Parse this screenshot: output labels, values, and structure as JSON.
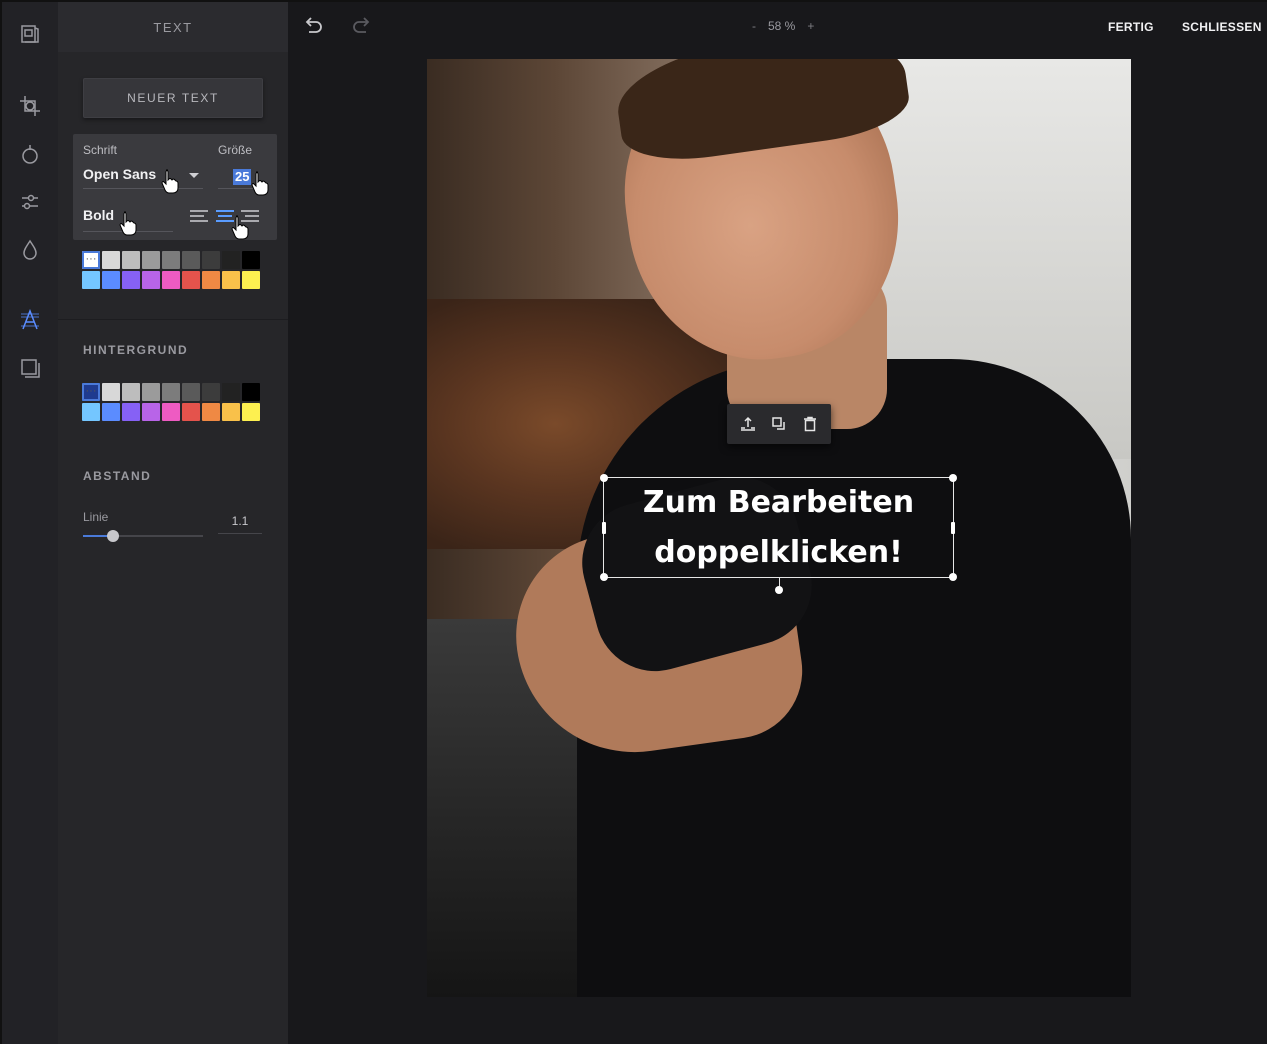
{
  "panel": {
    "title": "TEXT",
    "new_text_label": "NEUER TEXT",
    "font": {
      "font_label": "Schrift",
      "font_value": "Open Sans",
      "size_label": "Größe",
      "size_value": "25",
      "weight_value": "Bold"
    },
    "text_colors": [
      "#ffffff",
      "#d8d8d8",
      "#bdbdbd",
      "#9b9b9b",
      "#7c7c7c",
      "#5a5a5a",
      "#3c3c3c",
      "#222222",
      "#000000",
      "#74c6ff",
      "#5b8cff",
      "#8661f5",
      "#b864e8",
      "#ee5bc2",
      "#e4534c",
      "#ef8944",
      "#f9c14a",
      "#fdf050"
    ],
    "background_title": "HINTERGRUND",
    "background_colors": [
      "#1f3b8f",
      "#d8d8d8",
      "#bdbdbd",
      "#9b9b9b",
      "#7c7c7c",
      "#5a5a5a",
      "#3c3c3c",
      "#222222",
      "#000000",
      "#74c6ff",
      "#5b8cff",
      "#8661f5",
      "#b864e8",
      "#ee5bc2",
      "#e4534c",
      "#ef8944",
      "#f9c14a",
      "#fdf050"
    ],
    "spacing_title": "ABSTAND",
    "line_label": "Linie",
    "line_value": "1.1",
    "line_fraction": 0.25
  },
  "topbar": {
    "zoom_minus": "-",
    "zoom_value": "58 %",
    "zoom_plus": "+",
    "done_label": "FERTIG",
    "close_label": "SCHLIESSEN"
  },
  "canvas": {
    "text_line1": "Zum Bearbeiten",
    "text_line2": "doppelklicken!"
  },
  "colors": {
    "accent": "#4a7ad9",
    "panel_bg": "#262629"
  }
}
